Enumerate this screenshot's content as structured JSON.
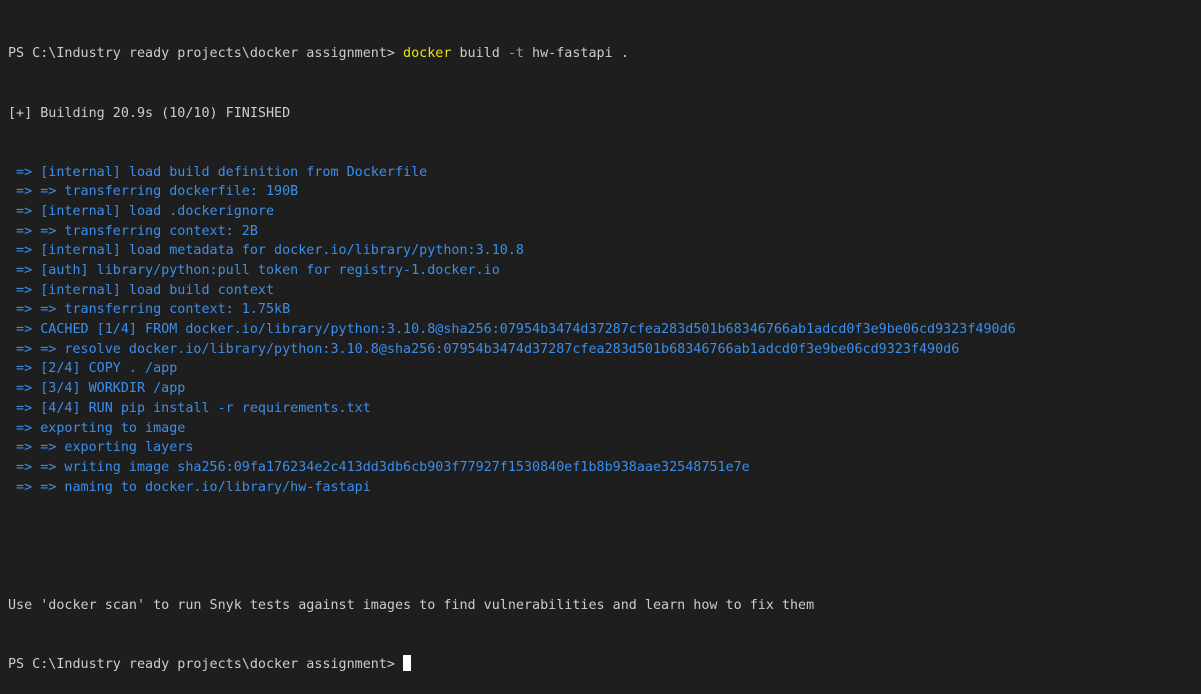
{
  "terminal": {
    "prompt_path": "PS C:\\Industry ready projects\\docker assignment>",
    "command": {
      "program": "docker",
      "subcommand": "build",
      "flag": "-t",
      "tag": "hw-fastapi",
      "context": "."
    },
    "status_line": "[+] Building 20.9s (10/10) FINISHED",
    "log_lines": [
      " => [internal] load build definition from Dockerfile",
      " => => transferring dockerfile: 190B",
      " => [internal] load .dockerignore",
      " => => transferring context: 2B",
      " => [internal] load metadata for docker.io/library/python:3.10.8",
      " => [auth] library/python:pull token for registry-1.docker.io",
      " => [internal] load build context",
      " => => transferring context: 1.75kB",
      " => CACHED [1/4] FROM docker.io/library/python:3.10.8@sha256:07954b3474d37287cfea283d501b68346766ab1adcd0f3e9be06cd9323f490d6",
      " => => resolve docker.io/library/python:3.10.8@sha256:07954b3474d37287cfea283d501b68346766ab1adcd0f3e9be06cd9323f490d6",
      " => [2/4] COPY . /app",
      " => [3/4] WORKDIR /app",
      " => [4/4] RUN pip install -r requirements.txt",
      " => exporting to image",
      " => => exporting layers",
      " => => writing image sha256:09fa176234e2c413dd3db6cb903f77927f1530840ef1b8b938aae32548751e7e",
      " => => naming to docker.io/library/hw-fastapi"
    ],
    "scan_hint": "Use 'docker scan' to run Snyk tests against images to find vulnerabilities and learn how to fix them",
    "colors": {
      "background": "#1e1e1e",
      "text": "#cccccc",
      "command": "#e5e510",
      "log": "#3b8eea"
    }
  }
}
